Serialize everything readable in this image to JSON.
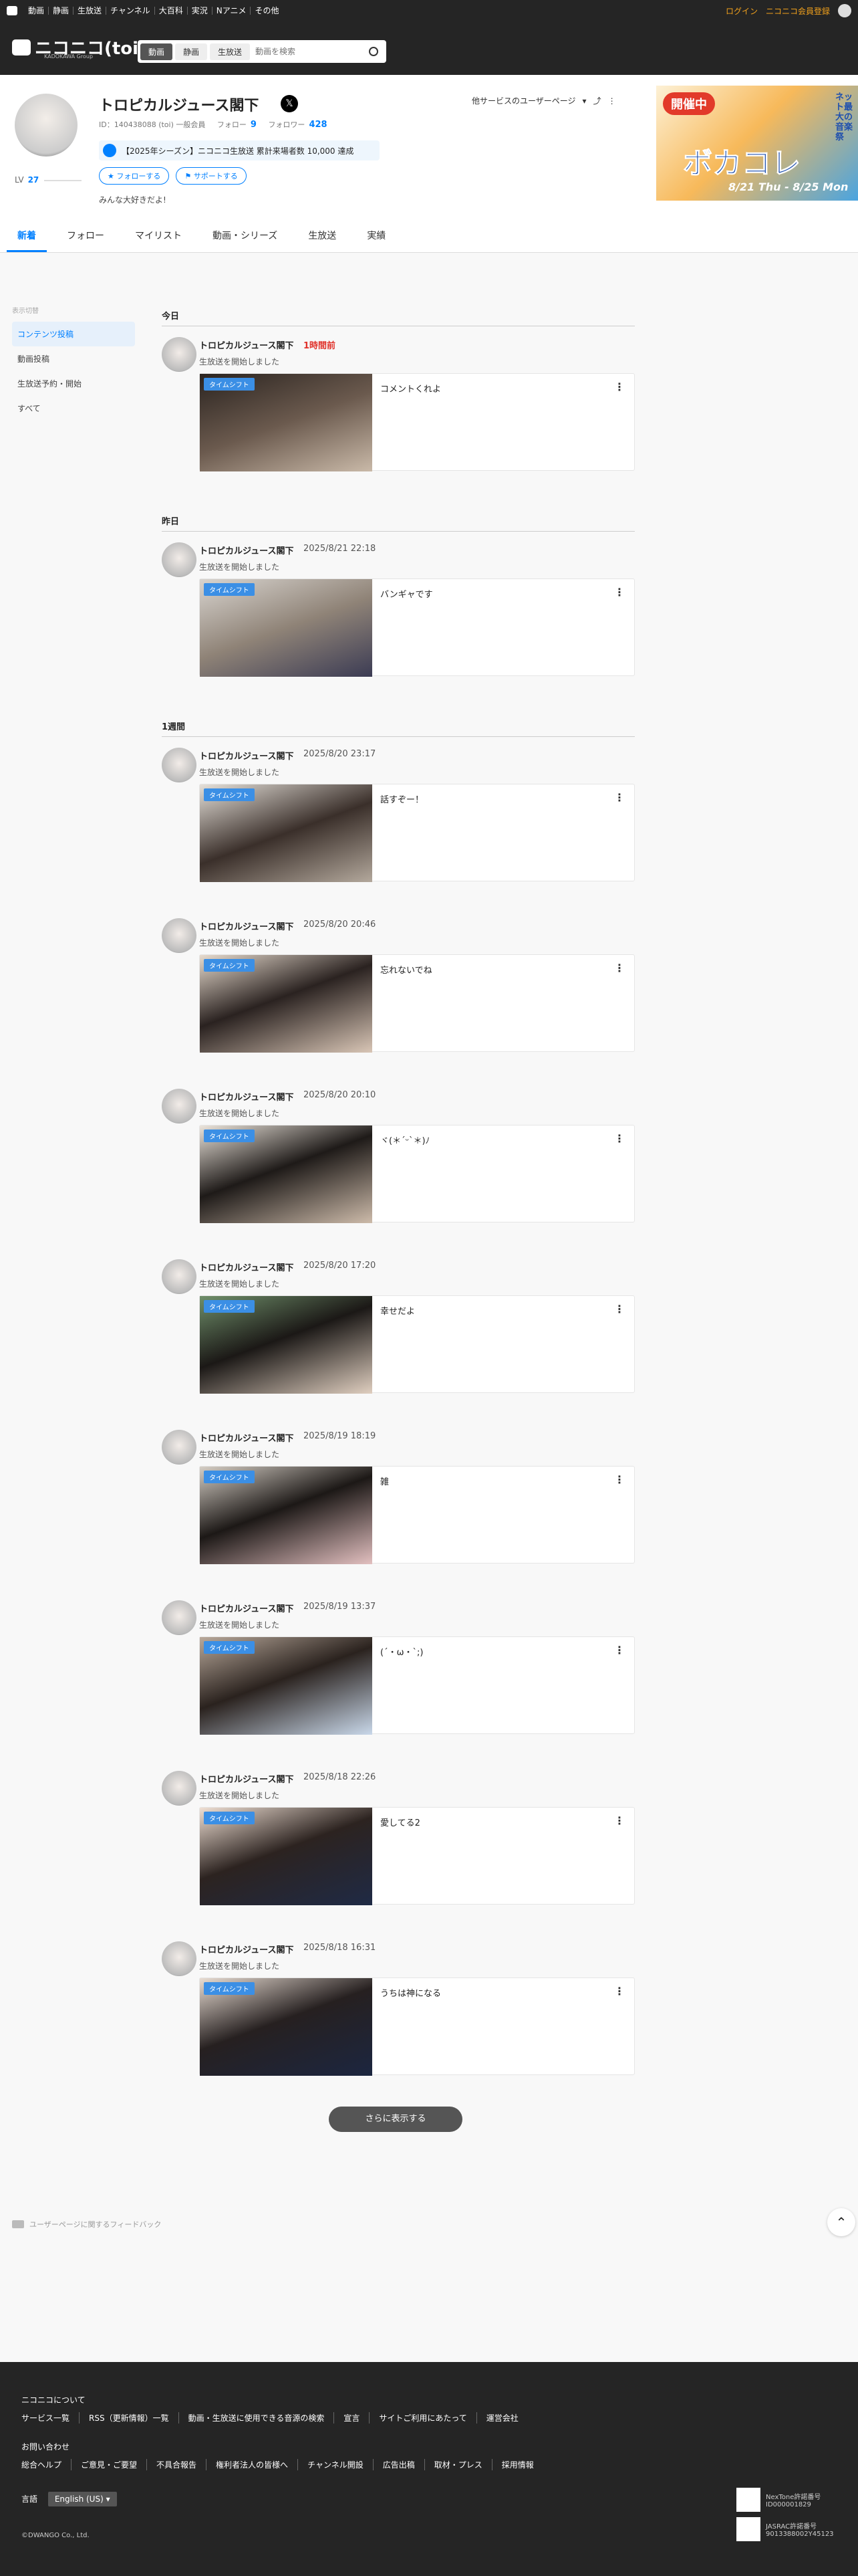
{
  "topbar": {
    "nav": [
      "動画",
      "静画",
      "生放送",
      "チャンネル",
      "大百科",
      "実況",
      "Nアニメ",
      "その他"
    ],
    "login": "ログイン",
    "register": "ニコニコ会員登録"
  },
  "header": {
    "logo": "ニコニコ(toi)",
    "logo_sub": "KADOKAWA Group",
    "search_tabs": [
      "動画",
      "静画",
      "生放送"
    ],
    "search_placeholder": "動画を検索"
  },
  "profile": {
    "name": "トロピカルジュース閣下",
    "meta_id": "ID：140438088 (toi) 一般会員",
    "follow_label": "フォロー",
    "follow_count": "9",
    "follower_label": "フォロワー",
    "follower_count": "428",
    "level_label": "LV",
    "level": "27",
    "badge": "【2025年シーズン】ニコニコ生放送 累計来場者数 10,000 達成",
    "follow_btn": "フォローする",
    "support_btn": "サポートする",
    "description": "みんな大好きだよ!",
    "other_services": "他サービスのユーザーページ"
  },
  "banner": {
    "kaisai": "開催中",
    "title": "ボカコレ",
    "date": "8/21 Thu - 8/25 Mon",
    "side": "ネット最大の音楽祭"
  },
  "tabs": [
    "新着",
    "フォロー",
    "マイリスト",
    "動画・シリーズ",
    "生放送",
    "実績"
  ],
  "sidemenu": {
    "header": "表示切替",
    "items": [
      "コンテンツ投稿",
      "動画投稿",
      "生放送予約・開始",
      "すべて"
    ]
  },
  "feed": {
    "badge": "タイムシフト",
    "action": "生放送を開始しました",
    "groups": [
      {
        "label": "今日",
        "entries": [
          {
            "time": "1時間前",
            "title": "コメントくれよ"
          }
        ]
      },
      {
        "label": "昨日",
        "entries": [
          {
            "time": "2025/8/21 22:18",
            "title": "バンギャです"
          }
        ]
      },
      {
        "label": "1週間",
        "entries": [
          {
            "time": "2025/8/20 23:17",
            "title": "話すぞー！"
          },
          {
            "time": "2025/8/20 20:46",
            "title": "忘れないでね"
          },
          {
            "time": "2025/8/20 20:10",
            "title": "ヾ(＊´ᵕ`＊)ﾉ"
          },
          {
            "time": "2025/8/20 17:20",
            "title": "幸せだよ"
          },
          {
            "time": "2025/8/19 18:19",
            "title": "雑"
          },
          {
            "time": "2025/8/19 13:37",
            "title": "(´・ω・`;)"
          },
          {
            "time": "2025/8/18 22:26",
            "title": "愛してる2"
          },
          {
            "time": "2025/8/18 16:31",
            "title": "うちは神になる"
          }
        ]
      }
    ],
    "more": "さらに表示する"
  },
  "feedback": "ユーザーページに関するフィードバック",
  "footer": {
    "about": "ニコニコについて",
    "about_links": [
      "サービス一覧",
      "RSS（更新情報）一覧",
      "動画・生放送に使用できる音源の検索",
      "宣言",
      "サイトご利用にあたって",
      "運営会社"
    ],
    "contact": "お問い合わせ",
    "contact_links": [
      "総合ヘルプ",
      "ご意見・ご要望",
      "不具合報告",
      "権利者法人の皆様へ",
      "チャンネル開設",
      "広告出稿",
      "取材・プレス",
      "採用情報"
    ],
    "lang_label": "言語",
    "lang_value": "English (US)",
    "cert1": "NexTone許諾番号\nID000001829",
    "cert2": "JASRAC許諾番号\n9013388002Y45123",
    "copyright": "©DWANGO Co., Ltd."
  }
}
